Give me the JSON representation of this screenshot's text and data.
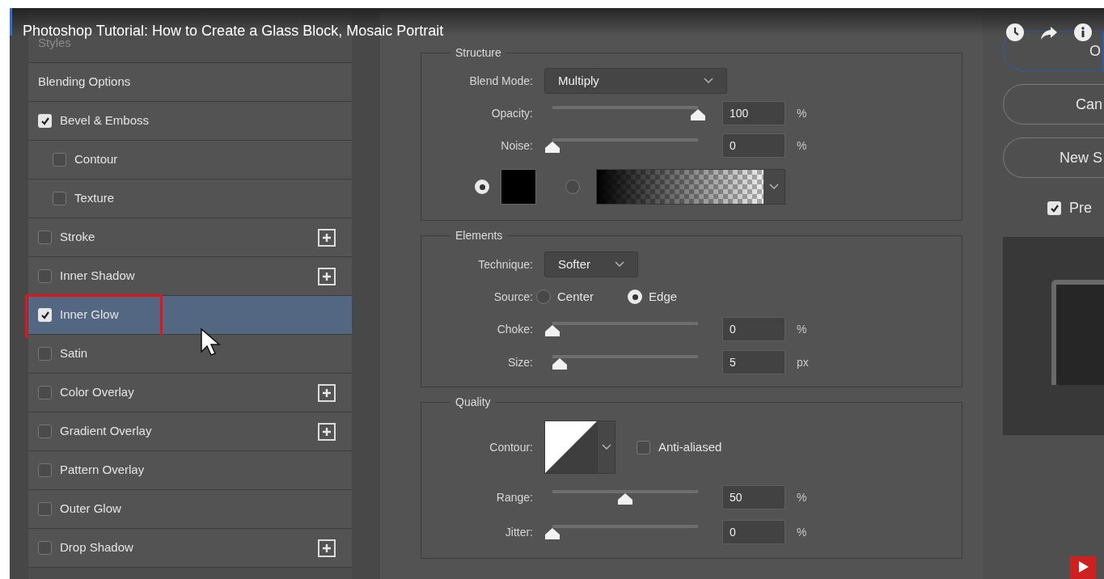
{
  "video_title": "Photoshop Tutorial: How to Create a Glass Block, Mosaic Portrait",
  "styles_panel": {
    "header": "Styles",
    "items": [
      {
        "label": "Blending Options",
        "kind": "plain",
        "selected": false
      },
      {
        "label": "Bevel & Emboss",
        "kind": "check",
        "checked": true,
        "selected": false,
        "add_button": false,
        "annotated": false,
        "children": [
          {
            "label": "Contour",
            "kind": "check",
            "checked": false,
            "selected": false,
            "add_button": false,
            "annotated": false
          },
          {
            "label": "Texture",
            "kind": "check",
            "checked": false,
            "selected": false,
            "add_button": false,
            "annotated": false
          }
        ]
      },
      {
        "label": "Stroke",
        "kind": "check",
        "checked": false,
        "selected": false,
        "add_button": true,
        "annotated": false
      },
      {
        "label": "Inner Shadow",
        "kind": "check",
        "checked": false,
        "selected": false,
        "add_button": true,
        "annotated": false
      },
      {
        "label": "Inner Glow",
        "kind": "check",
        "checked": true,
        "selected": true,
        "add_button": false,
        "annotated": true
      },
      {
        "label": "Satin",
        "kind": "check",
        "checked": false,
        "selected": false,
        "add_button": false,
        "annotated": false
      },
      {
        "label": "Color Overlay",
        "kind": "check",
        "checked": false,
        "selected": false,
        "add_button": true,
        "annotated": false
      },
      {
        "label": "Gradient Overlay",
        "kind": "check",
        "checked": false,
        "selected": false,
        "add_button": true,
        "annotated": false
      },
      {
        "label": "Pattern Overlay",
        "kind": "check",
        "checked": false,
        "selected": false,
        "add_button": false,
        "annotated": false
      },
      {
        "label": "Outer Glow",
        "kind": "check",
        "checked": false,
        "selected": false,
        "add_button": false,
        "annotated": false
      },
      {
        "label": "Drop Shadow",
        "kind": "check",
        "checked": false,
        "selected": false,
        "add_button": true,
        "annotated": false
      }
    ]
  },
  "structure": {
    "title": "Structure",
    "rows": [
      {
        "kind": "dropdown",
        "label": "Blend Mode:",
        "value": "Multiply"
      },
      {
        "kind": "slider",
        "label": "Opacity:",
        "level": 1,
        "value": "100",
        "unit": "%"
      },
      {
        "kind": "slider",
        "label": "Noise:",
        "level": 0,
        "value": "0",
        "unit": "%"
      },
      {
        "kind": "fill",
        "color_selected": true,
        "gradient_selected": false
      }
    ]
  },
  "elements": {
    "title": "Elements",
    "rows": [
      {
        "kind": "dropdown",
        "label": "Technique:",
        "value": "Softer"
      },
      {
        "kind": "radios",
        "label": "Source:",
        "options": [
          {
            "label": "Center",
            "selected": false
          },
          {
            "label": "Edge",
            "selected": true
          }
        ]
      },
      {
        "kind": "slider",
        "label": "Choke:",
        "level": 0,
        "value": "0",
        "unit": "%"
      },
      {
        "kind": "slider",
        "label": "Size:",
        "level": 0.05,
        "value": "5",
        "unit": "px"
      }
    ]
  },
  "quality": {
    "title": "Quality",
    "rows": [
      {
        "kind": "contour",
        "label": "Contour:",
        "checkbox_label": "Anti-aliased",
        "checked": false
      },
      {
        "kind": "slider",
        "label": "Range:",
        "level": 0.5,
        "value": "50",
        "unit": "%"
      },
      {
        "kind": "slider",
        "label": "Jitter:",
        "level": 0,
        "value": "0",
        "unit": "%"
      }
    ]
  },
  "buttons": [
    {
      "label": "O",
      "default": true
    },
    {
      "label": "Can",
      "default": false
    },
    {
      "label": "New S",
      "default": false
    }
  ],
  "preview": {
    "label": "Pre",
    "checked": true
  }
}
